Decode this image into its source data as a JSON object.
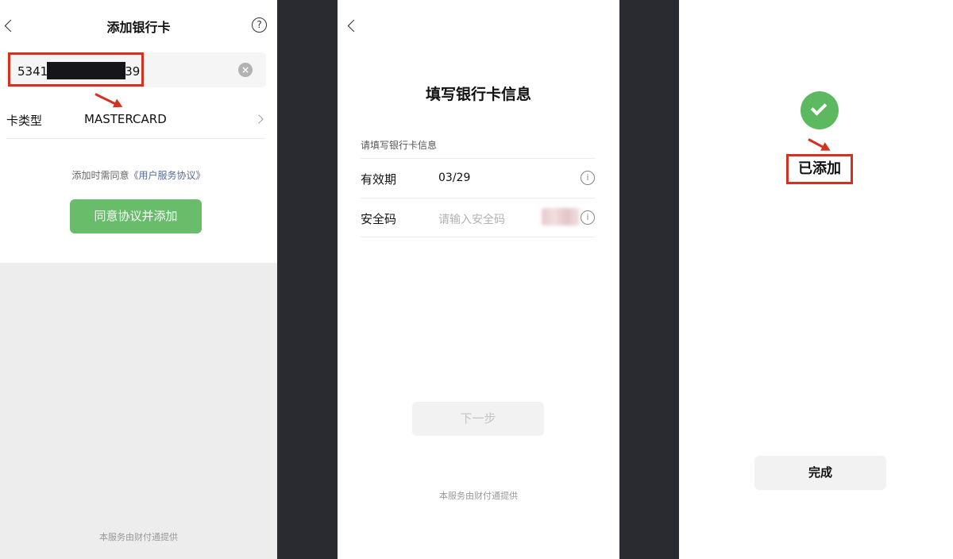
{
  "screen1": {
    "title": "添加银行卡",
    "help_icon": "?",
    "card_number_prefix": "5341",
    "card_number_suffix": "39",
    "clear_icon": "×",
    "card_type_label": "卡类型",
    "card_type_value": "MASTERCARD",
    "agree_prefix": "添加时需同意",
    "agree_link": "《用户服务协议》",
    "agree_button": "同意协议并添加",
    "footer": "本服务由财付通提供"
  },
  "screen2": {
    "title": "填写银行卡信息",
    "section_hint": "请填写银行卡信息",
    "expiry_label": "有效期",
    "expiry_value": "03/29",
    "cvv_label": "安全码",
    "cvv_placeholder": "请输入安全码",
    "info_icon": "i",
    "next_button": "下一步",
    "footer": "本服务由财付通提供"
  },
  "screen3": {
    "status_label": "已添加",
    "done_button": "完成"
  },
  "colors": {
    "primary_green": "#68bc6a",
    "success_green": "#5cb960",
    "highlight_red": "#d6301f",
    "link_blue": "#576b95",
    "divider_dark": "#2a2b30"
  },
  "icons": {
    "back": "chevron-left-icon",
    "help": "question-circle-icon",
    "clear": "clear-circle-icon",
    "disclosure": "chevron-right-icon",
    "info": "info-circle-icon",
    "success": "check-circle-icon"
  }
}
